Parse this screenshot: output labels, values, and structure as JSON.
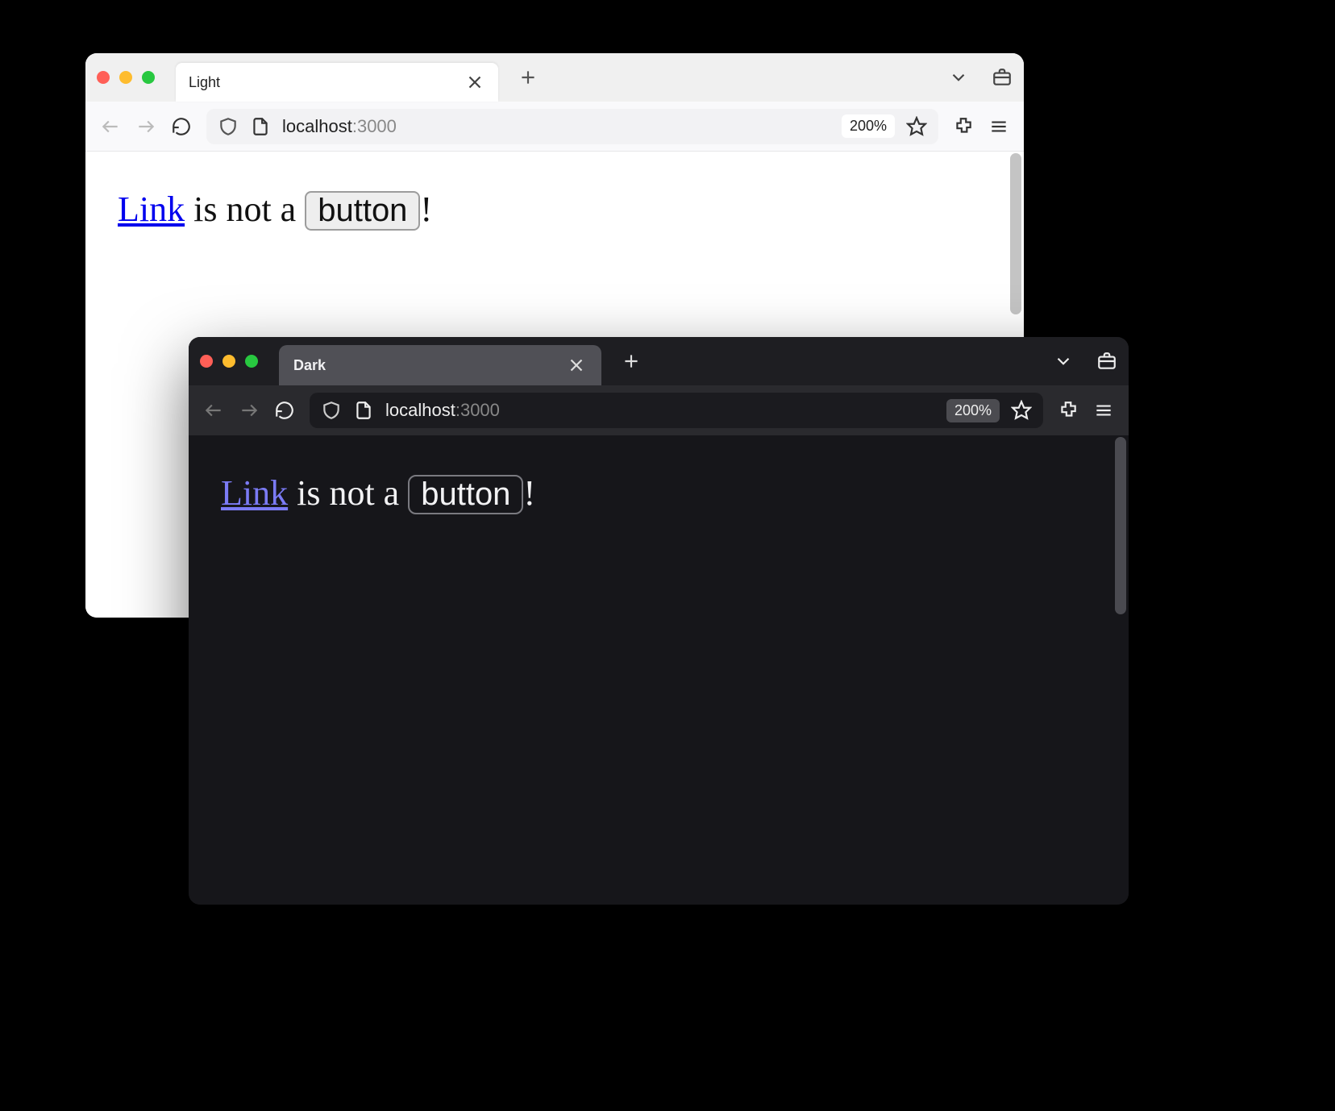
{
  "light": {
    "tab_title": "Light",
    "url_host": "localhost",
    "url_port": ":3000",
    "zoom": "200%",
    "content": {
      "link_text": "Link",
      "middle_text": " is not a ",
      "button_text": "button",
      "trailing_text": "!"
    }
  },
  "dark": {
    "tab_title": "Dark",
    "url_host": "localhost",
    "url_port": ":3000",
    "zoom": "200%",
    "content": {
      "link_text": "Link",
      "middle_text": " is not a ",
      "button_text": "button",
      "trailing_text": "!"
    }
  }
}
